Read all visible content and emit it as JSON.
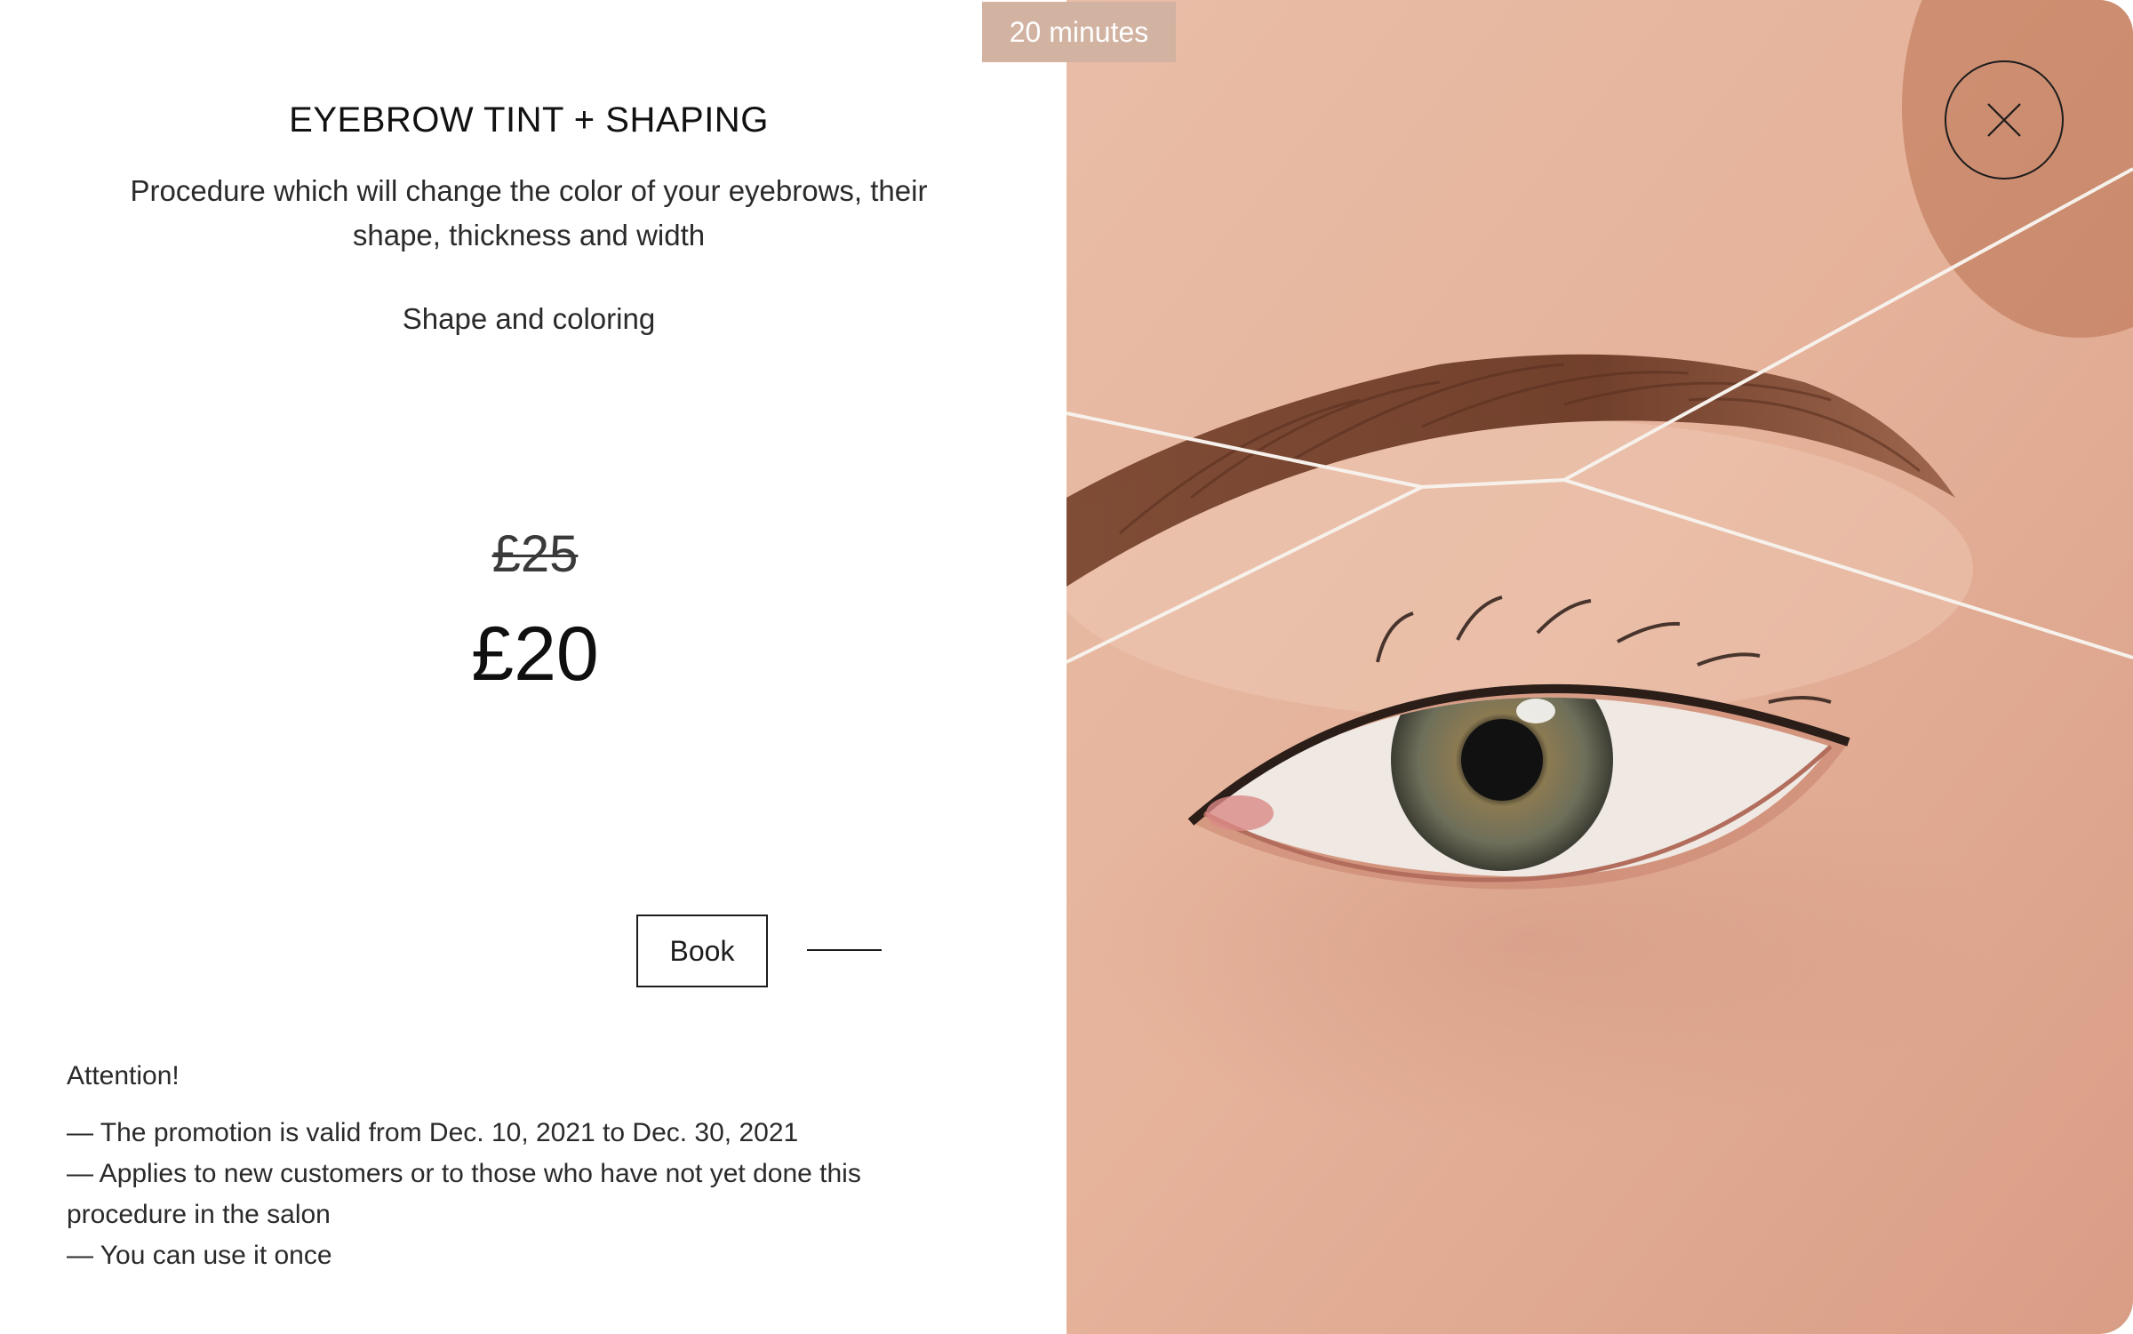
{
  "service": {
    "duration": "20 minutes",
    "title": "EYEBROW TINT + SHAPING",
    "description": "Procedure which will change the color of your eyebrows, their shape, thickness and width",
    "subtitle": "Shape and coloring",
    "old_price": "£25",
    "new_price": "£20",
    "book_label": "Book"
  },
  "notes": {
    "heading": "Attention!",
    "items": [
      "— The promotion is valid from Dec. 10, 2021 to Dec. 30, 2021",
      "— Applies to new customers or to those who have not yet done this procedure in the salon",
      "— You can use it once"
    ]
  },
  "colors": {
    "badge": "#d2b3a2",
    "text": "#1c1c1c",
    "skin": "#e6b9a3"
  },
  "icons": {
    "close": "close-icon"
  }
}
